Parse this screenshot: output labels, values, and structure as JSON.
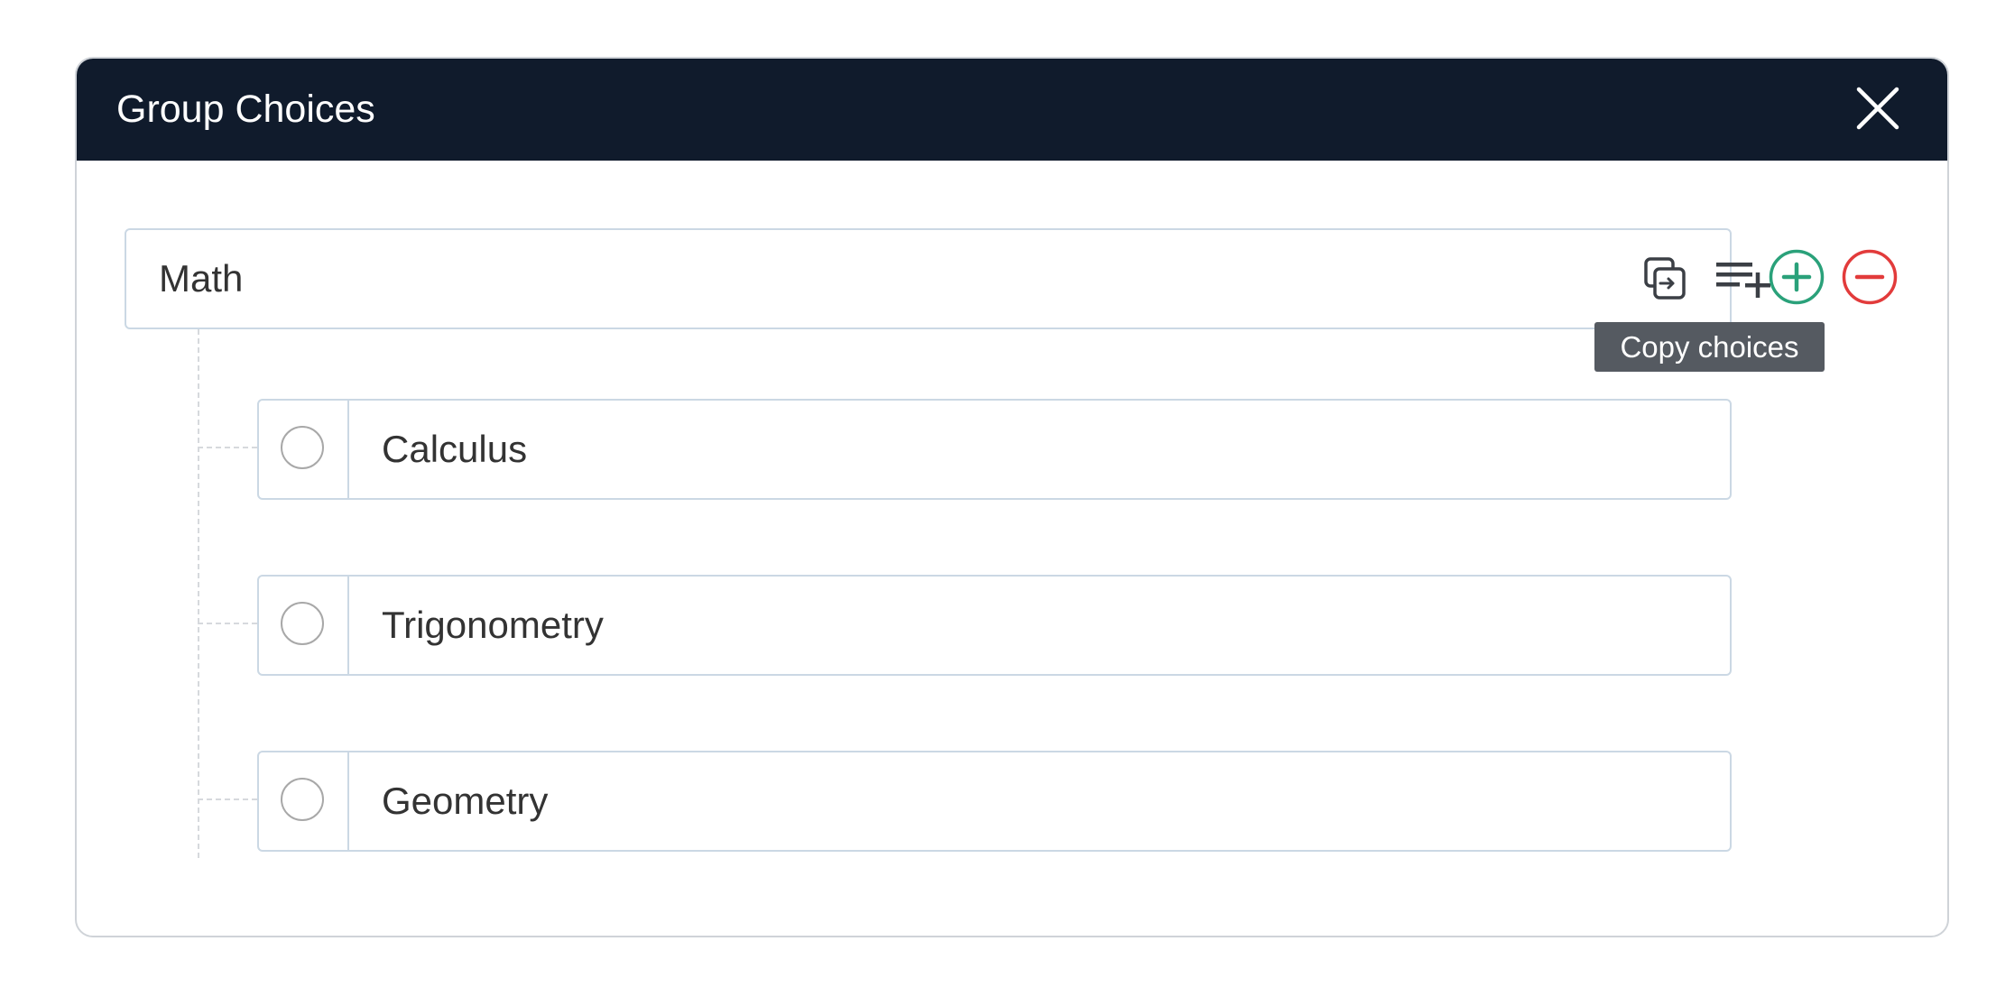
{
  "dialog": {
    "title": "Group Choices",
    "close_icon": "close-icon"
  },
  "group": {
    "name": "Math",
    "copy_icon": "copy-choices-icon",
    "add_list_icon": "playlist-add-icon",
    "add_icon": "plus-circle-icon",
    "remove_icon": "minus-circle-icon",
    "tooltip": "Copy choices"
  },
  "choices": [
    {
      "label": "Calculus"
    },
    {
      "label": "Trigonometry"
    },
    {
      "label": "Geometry"
    }
  ],
  "colors": {
    "header_bg": "#101b2c",
    "add_green": "#2aa17a",
    "remove_red": "#e23b3b",
    "border": "#cbd8e4",
    "tooltip_bg": "#555a61"
  }
}
